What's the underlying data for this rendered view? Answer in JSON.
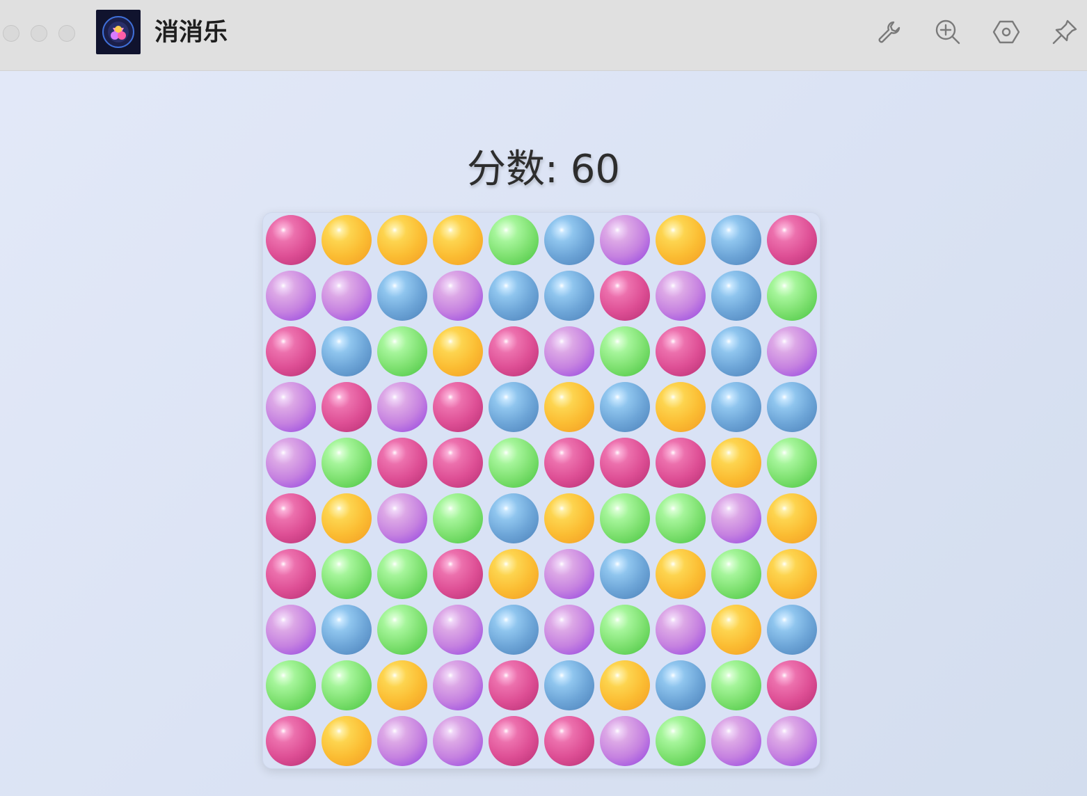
{
  "window": {
    "title": "消消乐",
    "app_icon": "candy-crush-app-icon",
    "controls": [
      "close",
      "minimize",
      "maximize"
    ],
    "toolbar": [
      {
        "name": "wrench-icon",
        "label": "tools"
      },
      {
        "name": "zoom-in-icon",
        "label": "zoom"
      },
      {
        "name": "settings-hexagon-icon",
        "label": "settings"
      },
      {
        "name": "pin-icon",
        "label": "pin"
      }
    ]
  },
  "game": {
    "score_label": "分数: 60",
    "score": 60,
    "rows": 10,
    "cols": 10,
    "colors": {
      "red": "#de4f95",
      "orange": "#fbbd33",
      "green": "#7fe171",
      "blue": "#6ea6d8",
      "purple": "#c682e0"
    },
    "grid": [
      [
        "red",
        "orange",
        "orange",
        "orange",
        "green",
        "blue",
        "purple",
        "orange",
        "blue",
        "red"
      ],
      [
        "purple",
        "purple",
        "blue",
        "purple",
        "blue",
        "blue",
        "red",
        "purple",
        "blue",
        "green"
      ],
      [
        "red",
        "blue",
        "green",
        "orange",
        "red",
        "purple",
        "green",
        "red",
        "blue",
        "purple"
      ],
      [
        "purple",
        "red",
        "purple",
        "red",
        "blue",
        "orange",
        "blue",
        "orange",
        "blue",
        "blue"
      ],
      [
        "purple",
        "green",
        "red",
        "red",
        "green",
        "red",
        "red",
        "red",
        "orange",
        "green"
      ],
      [
        "red",
        "orange",
        "purple",
        "green",
        "blue",
        "orange",
        "green",
        "green",
        "purple",
        "orange"
      ],
      [
        "red",
        "green",
        "green",
        "red",
        "orange",
        "purple",
        "blue",
        "orange",
        "green",
        "orange"
      ],
      [
        "purple",
        "blue",
        "green",
        "purple",
        "blue",
        "purple",
        "green",
        "purple",
        "orange",
        "blue"
      ],
      [
        "green",
        "green",
        "orange",
        "purple",
        "red",
        "blue",
        "orange",
        "blue",
        "green",
        "red"
      ],
      [
        "red",
        "orange",
        "purple",
        "purple",
        "red",
        "red",
        "purple",
        "green",
        "purple",
        "purple"
      ]
    ]
  }
}
